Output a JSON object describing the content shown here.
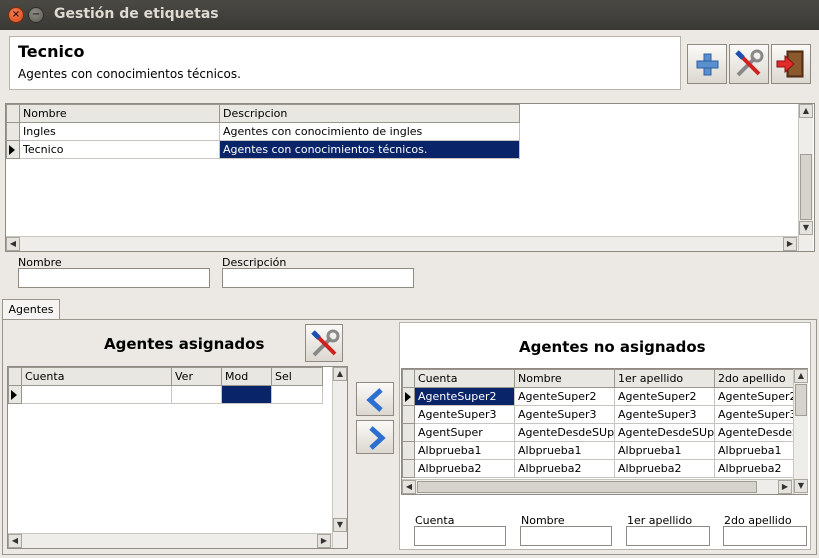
{
  "window": {
    "title": "Gestión de etiquetas"
  },
  "header": {
    "title": "Tecnico",
    "description": "Agentes con conocimientos técnicos."
  },
  "toolbar": {
    "icons": [
      "plus-icon",
      "tools-icon",
      "exit-door-icon"
    ]
  },
  "tags_table": {
    "columns": [
      "Nombre",
      "Descripcion"
    ],
    "rows": [
      {
        "name": "Ingles",
        "description": "Agentes con conocimiento de ingles"
      },
      {
        "name": "Tecnico",
        "description": "Agentes con conocimientos técnicos."
      }
    ],
    "selected_row": 1
  },
  "tag_filters": {
    "name_label": "Nombre",
    "description_label": "Descripción",
    "name_value": "",
    "description_value": ""
  },
  "tabs": [
    {
      "label": "Agentes"
    }
  ],
  "assigned": {
    "title": "Agentes asignados",
    "columns": [
      "Cuenta",
      "Ver",
      "Mod",
      "Sel"
    ]
  },
  "unassigned": {
    "title": "Agentes no asignados",
    "columns": [
      "Cuenta",
      "Nombre",
      "1er apellido",
      "2do apellido"
    ],
    "rows": [
      [
        "AgenteSuper2",
        "AgenteSuper2",
        "AgenteSuper2",
        "AgenteSuper2"
      ],
      [
        "AgenteSuper3",
        "AgenteSuper3",
        "AgenteSuper3",
        "AgenteSuper3"
      ],
      [
        "AgentSuper",
        "AgenteDesdeSUpe",
        "AgenteDesdeSUpe",
        "AgenteDesdeS"
      ],
      [
        "Albprueba1",
        "Albprueba1",
        "Albprueba1",
        "Albprueba1"
      ],
      [
        "Albprueba2",
        "Albprueba2",
        "Albprueba2",
        "Albprueba2"
      ]
    ],
    "filters": {
      "account_label": "Cuenta",
      "name_label": "Nombre",
      "surname1_label": "1er apellido",
      "surname2_label": "2do apellido"
    }
  },
  "colors": {
    "selection": "#0a246a",
    "titlebar": "#3c3b37",
    "close_button": "#e95420"
  }
}
